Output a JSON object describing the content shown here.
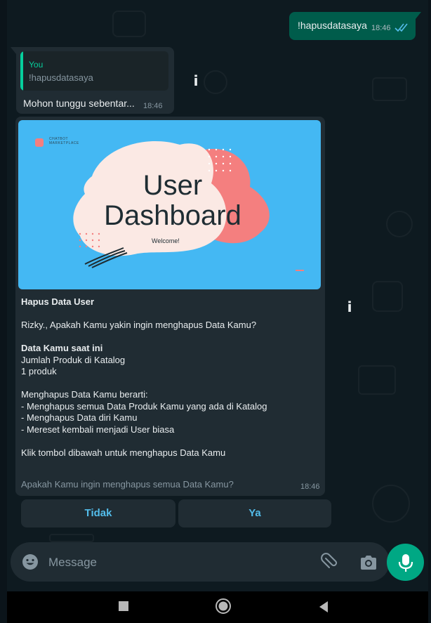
{
  "outgoing": {
    "text": "!hapusdatasaya",
    "time": "18:46",
    "status_icon": "double-check-icon"
  },
  "reply": {
    "quoted_author": "You",
    "quoted_text": "!hapusdatasaya",
    "text": "Mohon tunggu sebentar...",
    "time": "18:46"
  },
  "card": {
    "banner": {
      "brand_line1": "CHATBOT",
      "brand_line2": "MARKETPLACE",
      "title_line1": "User",
      "title_line2": "Dashboard",
      "welcome": "Welcome!"
    },
    "heading": "Hapus Data User",
    "question": "Rizky., Apakah Kamu yakin ingin menghapus Data Kamu?",
    "current_data_label": "Data Kamu saat ini",
    "catalog_label": "Jumlah Produk di Katalog",
    "catalog_count": "1 produk",
    "means_label": "Menghapus Data Kamu berarti:",
    "consequences": [
      "- Menghapus semua Data Produk Kamu yang ada di Katalog",
      "- Menghapus Data diri Kamu",
      "- Mereset kembali menjadi User biasa"
    ],
    "instruction": "Klik tombol dibawah untuk menghapus Data Kamu",
    "footer": "Apakah Kamu ingin menghapus semua Data Kamu?",
    "time": "18:46"
  },
  "buttons": {
    "no": "Tidak",
    "yes": "Ya"
  },
  "compose": {
    "placeholder": "Message"
  },
  "colors": {
    "chat_bg": "#0e1a20",
    "bubble_out": "#005c4b",
    "bubble_in": "#202c33",
    "accent": "#00a884",
    "link": "#53bdeb",
    "banner": "#44b8f3"
  }
}
